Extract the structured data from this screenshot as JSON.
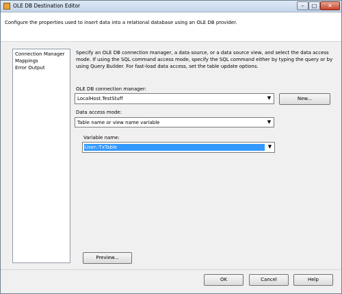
{
  "window": {
    "title": "OLE DB Destination Editor"
  },
  "header": {
    "description": "Configure the properties used to insert data into a relational database using an OLE DB provider."
  },
  "nav": {
    "items": [
      {
        "label": "Connection Manager"
      },
      {
        "label": "Mappings"
      },
      {
        "label": "Error Output"
      }
    ]
  },
  "main": {
    "description": "Specify an OLE DB connection manager, a data source, or a data source view, and select the data access mode. If using the SQL command access mode, specify the SQL command either by typing the query or by using Query Builder. For fast-load data access, set the table update options.",
    "connection_label": "OLE DB connection manager:",
    "connection_value": "LocalHost.TestStuff",
    "new_label": "New...",
    "access_mode_label": "Data access mode:",
    "access_mode_value": "Table name or view name variable",
    "variable_label": "Variable name:",
    "variable_value": "User::TxTable",
    "preview_label": "Preview..."
  },
  "footer": {
    "ok_label": "OK",
    "cancel_label": "Cancel",
    "help_label": "Help"
  },
  "colors": {
    "selection": "#3399ff"
  }
}
